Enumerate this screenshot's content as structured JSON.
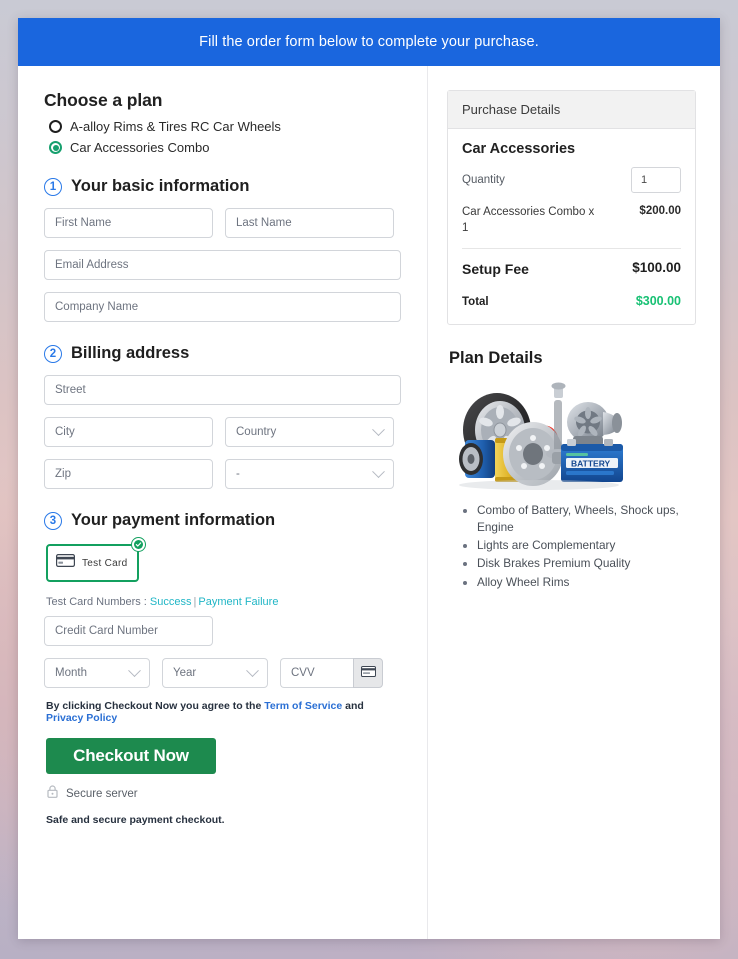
{
  "banner": {
    "text": "Fill the order form below to complete your purchase."
  },
  "plan": {
    "title": "Choose a plan",
    "options": [
      {
        "label": "A-alloy Rims & Tires RC Car Wheels",
        "selected": false
      },
      {
        "label": "Car Accessories Combo",
        "selected": true
      }
    ]
  },
  "steps": {
    "basic": {
      "num": "1",
      "title": "Your basic information"
    },
    "billing": {
      "num": "2",
      "title": "Billing address"
    },
    "payment": {
      "num": "3",
      "title": "Your payment information"
    }
  },
  "fields": {
    "first_name": "First Name",
    "last_name": "Last Name",
    "email": "Email Address",
    "company": "Company Name",
    "street": "Street",
    "city": "City",
    "country": "Country",
    "zip": "Zip",
    "state": "-",
    "card_number": "Credit Card Number",
    "month": "Month",
    "year": "Year",
    "cvv": "CVV"
  },
  "payment": {
    "method_label": "Test Card",
    "testcards_prefix": "Test Card Numbers : ",
    "success_link": "Success",
    "separator": "|",
    "failure_link": "Payment Failure"
  },
  "footer": {
    "terms_prefix": "By clicking Checkout Now you agree to the ",
    "terms_link": "Term of Service",
    "terms_middle": " and ",
    "privacy_link": "Privacy Policy",
    "checkout_label": "Checkout Now",
    "secure_server": "Secure server",
    "safe_note": "Safe and secure payment checkout."
  },
  "purchase": {
    "panel_title": "Purchase Details",
    "product": "Car Accessories",
    "quantity_label": "Quantity",
    "quantity_value": "1",
    "item_label": "Car Accessories Combo x 1",
    "item_amount": "$200.00",
    "setup_label": "Setup Fee",
    "setup_amount": "$100.00",
    "total_label": "Total",
    "total_amount": "$300.00"
  },
  "plan_details": {
    "title": "Plan Details",
    "features": [
      "Combo of Battery, Wheels, Shock ups, Engine",
      "Lights are Complementary",
      "Disk Brakes Premium Quality",
      "Alloy Wheel Rims"
    ]
  },
  "colors": {
    "banner_blue": "#1a66de",
    "step_blue": "#2979e8",
    "selected_green": "#13a05f",
    "checkout_green": "#1d8a4e",
    "total_green": "#18c174",
    "link_teal": "#21b6c6",
    "link_blue": "#2a6fd4"
  }
}
